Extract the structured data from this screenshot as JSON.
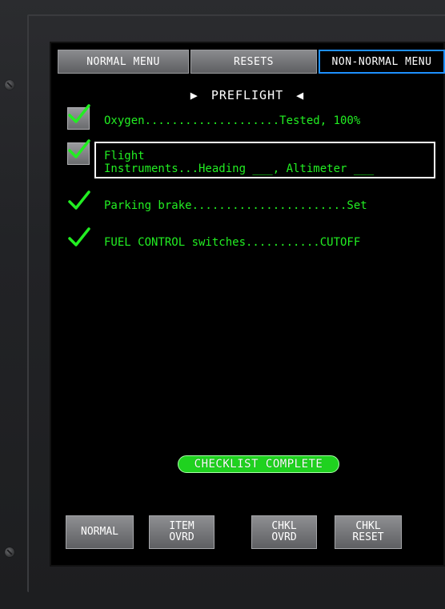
{
  "tabs": [
    {
      "label": "NORMAL MENU",
      "active": false
    },
    {
      "label": "RESETS",
      "active": false
    },
    {
      "label": "NON-NORMAL MENU",
      "active": true
    }
  ],
  "page_title": "PREFLIGHT",
  "items": [
    {
      "text": "Oxygen....................Tested, 100%",
      "checked": true,
      "has_box": true
    },
    {
      "line1": "Flight",
      "line2": "Instruments...Heading ___, Altimeter ___",
      "checked": true,
      "has_box": true,
      "highlighted": true
    },
    {
      "text": "Parking brake.......................Set",
      "checked": true,
      "has_box": false
    },
    {
      "text": "FUEL CONTROL switches...........CUTOFF",
      "checked": true,
      "has_box": false
    }
  ],
  "status": "CHECKLIST COMPLETE",
  "buttons": [
    {
      "line1": "NORMAL",
      "line2": ""
    },
    {
      "line1": "ITEM",
      "line2": "OVRD"
    },
    {
      "line1": "CHKL",
      "line2": "OVRD"
    },
    {
      "line1": "CHKL",
      "line2": "RESET"
    }
  ],
  "colors": {
    "checklist_text": "#22ee22",
    "active_tab_border": "#1e90ff",
    "complete_pill": "#1fd21f"
  }
}
